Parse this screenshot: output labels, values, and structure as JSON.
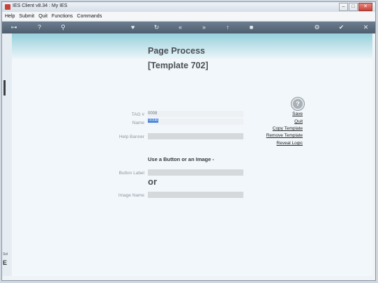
{
  "window": {
    "title": "IES Client v8.34 : My IES"
  },
  "menu": [
    "Help",
    "Submit",
    "Quit",
    "Functions",
    "Commands"
  ],
  "toolbar": {
    "icons": [
      "key-icon",
      "help-icon",
      "search-icon",
      "heart-icon",
      "refresh-icon",
      "rewind-icon",
      "fast-forward-icon",
      "up-icon",
      "stop-icon",
      "settings-icon",
      "check-icon",
      "close-icon"
    ]
  },
  "page": {
    "title": "Page Process",
    "subtitle": "[Template 702]",
    "tag_label": "TAG #",
    "tag_value": "0008",
    "name_label": "Name",
    "name_value": "0008",
    "help_banner_label": "Help Banner",
    "use_button_text": "Use a Button or an Image -",
    "button_label": "Button Label",
    "or_text": "or",
    "image_name_label": "Image Name"
  },
  "actions": {
    "help_glyph": "?",
    "save": "Save",
    "quit": "Quit",
    "copy_template": "Copy Template",
    "remove_template": "Remove Template",
    "reveal_logic": "Reveal Logic"
  },
  "side": {
    "label": "Sel",
    "letter": "E"
  }
}
